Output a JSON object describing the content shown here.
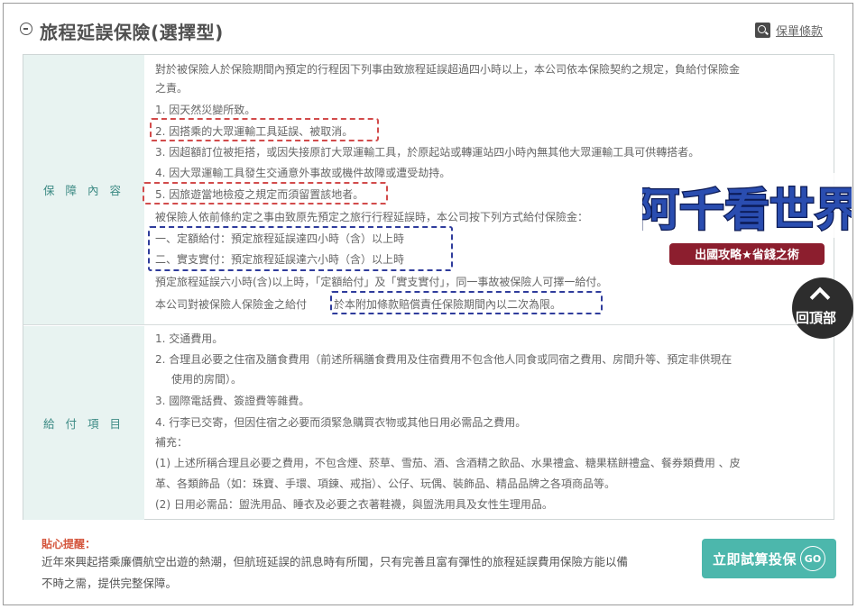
{
  "header": {
    "title": "旅程延誤保險(選擇型)",
    "terms_link": "保單條款"
  },
  "coverage": {
    "heading": "保 障 內 容",
    "lines": [
      "對於被保險人於保險期間內預定的行程因下列事由致旅程延誤超過四小時以上，本公司依本保險契約之規定，負給付保險金",
      "之責。",
      "1. 因天然災變所致。",
      "2. 因搭乘的大眾運輸工具延誤、被取消。",
      "3. 因超額訂位被拒搭，或因失接原訂大眾運輸工具，於原起站或轉運站四小時內無其他大眾運輸工具可供轉搭者。",
      "4. 因大眾運輸工具發生交通意外事故或機件故障或遭受劫持。",
      "5. 因旅遊當地檢疫之規定而須留置該地者。",
      "被保險人依前條約定之事由致原先預定之旅行行程延誤時，本公司按下列方式給付保險金：",
      "一、定額給付：預定旅程延誤達四小時（含）以上時",
      "二、實支實付：預定旅程延誤達六小時（含）以上時",
      "預定旅程延誤六小時(含)以上時，「定額給付」及「實支實付」，同一事故被保險人可擇一給付。",
      "本公司對被保險人保險金之給付",
      "於本附加條款賠償責任保險期間內以二次為限。"
    ]
  },
  "payment": {
    "heading": "給 付 項 目",
    "lines": [
      "1. 交通費用。",
      "2. 合理且必要之住宿及膳食費用（前述所稱膳食費用及住宿費用不包含他人同食或同宿之費用、房間升等、預定非供現在",
      "使用的房間）。",
      "3. 國際電話費、簽證費等雜費。",
      "4. 行李已交寄，但因住宿之必要而須緊急購買衣物或其他日用必需品之費用。",
      "補充：",
      "(1) 上述所稱合理且必要之費用，不包含煙、菸草、雪茄、酒、含酒精之飲品、水果禮盒、糖果糕餅禮盒、餐券類費用 、皮",
      "革、各類飾品（如：珠寶、手環、項鍊、戒指）、公仔、玩偶、裝飾品、精品品牌之各項商品等。",
      "(2) 日用必需品：盥洗用品、睡衣及必要之衣著鞋襪，與盥洗用具及女性生理用品。"
    ]
  },
  "tip": {
    "title": "貼心提醒：",
    "lines": [
      "近年來興起搭乘廉價航空出遊的熱潮，但航班延誤的訊息時有所聞，只有完善且富有彈性的旅程延誤費用保險方能以備",
      "不時之需，提供完整保障。"
    ]
  },
  "cta": {
    "label": "立即試算投保",
    "go": "GO"
  },
  "watermark": {
    "brand": "阿千看世界",
    "slogan": "出國攻略★省錢之術"
  },
  "back_to_top": {
    "label": "回頂部"
  },
  "colors": {
    "accent": "#4cb7ac",
    "label_bg": "#e8f3f1",
    "label_text": "#3c8a84",
    "highlight_red": "#d24b4b",
    "highlight_blue": "#2f3c9c",
    "tip_title": "#d4553c"
  }
}
